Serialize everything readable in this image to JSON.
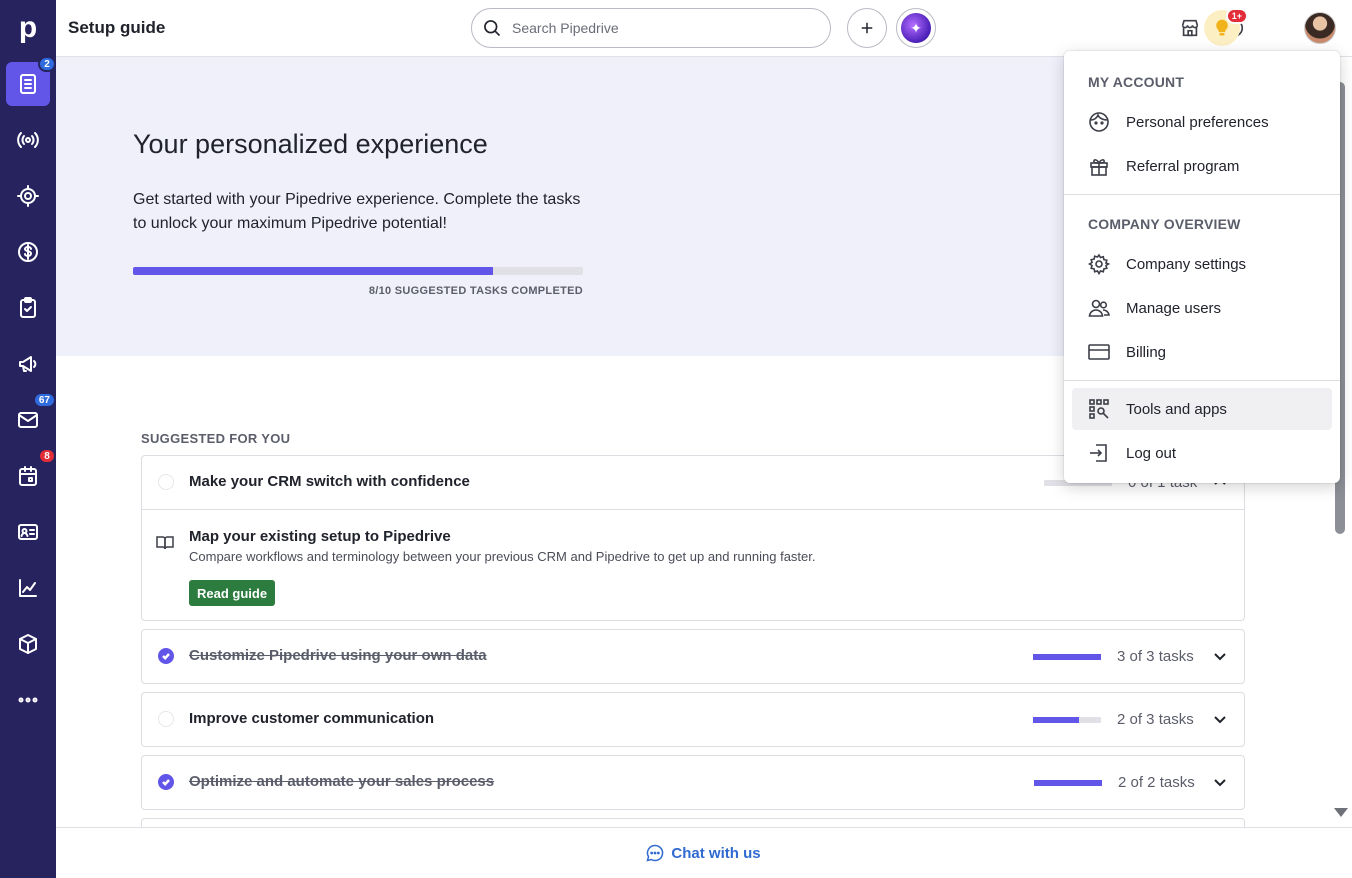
{
  "header": {
    "title": "Setup guide",
    "search_placeholder": "Search Pipedrive",
    "tips_badge": "1+"
  },
  "sidebar": {
    "logo": "p",
    "items": [
      {
        "name": "setup-guide",
        "badge": "2"
      },
      {
        "name": "leads"
      },
      {
        "name": "deals-pipeline"
      },
      {
        "name": "deals"
      },
      {
        "name": "activities"
      },
      {
        "name": "campaigns"
      },
      {
        "name": "mail",
        "badge": "67"
      },
      {
        "name": "calendar",
        "badge": "8"
      },
      {
        "name": "contacts"
      },
      {
        "name": "insights"
      },
      {
        "name": "products"
      },
      {
        "name": "more"
      }
    ]
  },
  "hero": {
    "title": "Your personalized experience",
    "description": "Get started with your Pipedrive experience. Complete the tasks to unlock your maximum Pipedrive potential!",
    "progress_fraction": 0.8,
    "progress_label": "8/10 SUGGESTED TASKS COMPLETED"
  },
  "suggested": {
    "label": "SUGGESTED FOR YOU",
    "tasks": [
      {
        "title": "Make your CRM switch with confidence",
        "count": "0 of 1 task",
        "done": false,
        "progress": 0.0
      },
      {
        "title": "Customize Pipedrive using your own data",
        "count": "3 of 3 tasks",
        "done": true,
        "progress": 1.0
      },
      {
        "title": "Improve customer communication",
        "count": "2 of 3 tasks",
        "done": false,
        "progress": 0.67
      },
      {
        "title": "Optimize and automate your sales process",
        "count": "2 of 2 tasks",
        "done": true,
        "progress": 1.0
      }
    ],
    "subtask": {
      "title": "Map your existing setup to Pipedrive",
      "description": "Compare workflows and terminology between your previous CRM and Pipedrive to get up and running faster.",
      "button": "Read guide"
    }
  },
  "footer": {
    "chat": "Chat with us"
  },
  "account_menu": {
    "my_account_label": "MY ACCOUNT",
    "personal_preferences": "Personal preferences",
    "referral_program": "Referral program",
    "company_overview_label": "COMPANY OVERVIEW",
    "company_settings": "Company settings",
    "manage_users": "Manage users",
    "billing": "Billing",
    "tools_and_apps": "Tools and apps",
    "log_out": "Log out"
  },
  "colors": {
    "sidebar": "#26235e",
    "accent": "#6156e8",
    "read_guide": "#2d7c3f",
    "link": "#316ad1"
  }
}
